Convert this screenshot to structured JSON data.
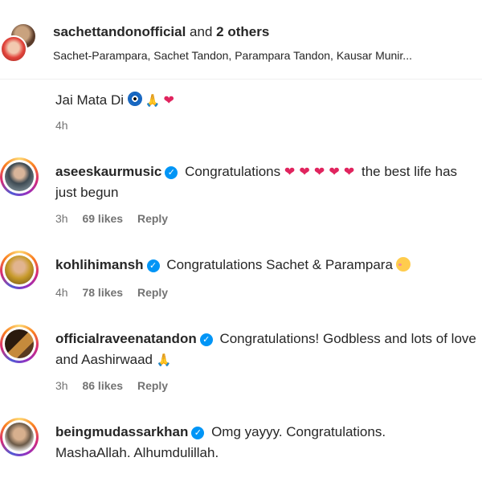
{
  "header": {
    "user": "sachettandonofficial",
    "and": "and",
    "others": "2 others",
    "subtitle": "Sachet-Parampara, Sachet Tandon, Parampara Tandon, Kausar Munir..."
  },
  "partial_comment": {
    "text": "Jai Mata Di",
    "time": "4h"
  },
  "comments": [
    {
      "username": "aseeskaurmusic",
      "text_before": "Congratulations",
      "hearts": "❤ ❤ ❤ ❤ ❤",
      "text_after": "the best life has just begun",
      "time": "3h",
      "likes": "69 likes",
      "reply": "Reply"
    },
    {
      "username": "kohlihimansh",
      "text": "Congratulations Sachet & Parampara",
      "time": "4h",
      "likes": "78 likes",
      "reply": "Reply"
    },
    {
      "username": "officialraveenatandon",
      "text": "Congratulations! Godbless and lots of love and Aashirwaad",
      "time": "3h",
      "likes": "86 likes",
      "reply": "Reply"
    },
    {
      "username": "beingmudassarkhan",
      "text": "Omg yayyy. Congratulations. MashaAllah. Alhumdulillah."
    }
  ],
  "icons": [
    "verified-badge-icon",
    "red-heart-icon",
    "nazar-amulet-icon",
    "folded-hands-icon",
    "smiling-face-with-hearts-icon"
  ],
  "colors": {
    "verified": "#0095f6",
    "heart": "#e0245e",
    "meta_text": "#737373"
  }
}
